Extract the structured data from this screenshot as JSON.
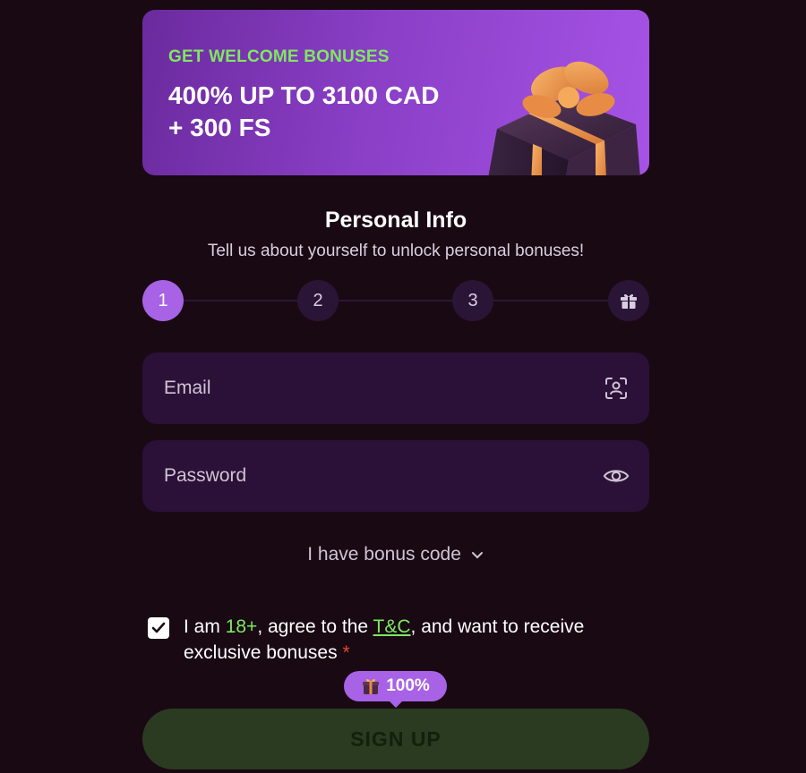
{
  "banner": {
    "kicker": "GET WELCOME BONUSES",
    "title_line1": "400% UP TO 3100 CAD",
    "title_line2": "+ 300 FS"
  },
  "heading": "Personal Info",
  "subheading": "Tell us about yourself to unlock personal bonuses!",
  "stepper": {
    "steps": [
      "1",
      "2",
      "3"
    ],
    "active_step": 1,
    "final_icon": "gift-icon"
  },
  "email": {
    "placeholder": "Email",
    "value": "",
    "icon": "contact-scan-icon"
  },
  "password": {
    "placeholder": "Password",
    "value": "",
    "icon": "eye-icon"
  },
  "bonus_code_label": "I have bonus code",
  "agreement": {
    "checked": true,
    "text_1": "I am ",
    "age": "18+",
    "text_2": ", agree to the ",
    "tc_link": "T&C",
    "text_3": ", and want to receive exclusive bonuses",
    "required_mark": "*"
  },
  "progress_badge": "100%",
  "signup_label": "SIGN UP",
  "colors": {
    "background": "#190913",
    "accent_purple": "#a862e6",
    "accent_green": "#7ee860",
    "field_bg": "#2b1137",
    "signup_bg": "#2a3b21"
  }
}
